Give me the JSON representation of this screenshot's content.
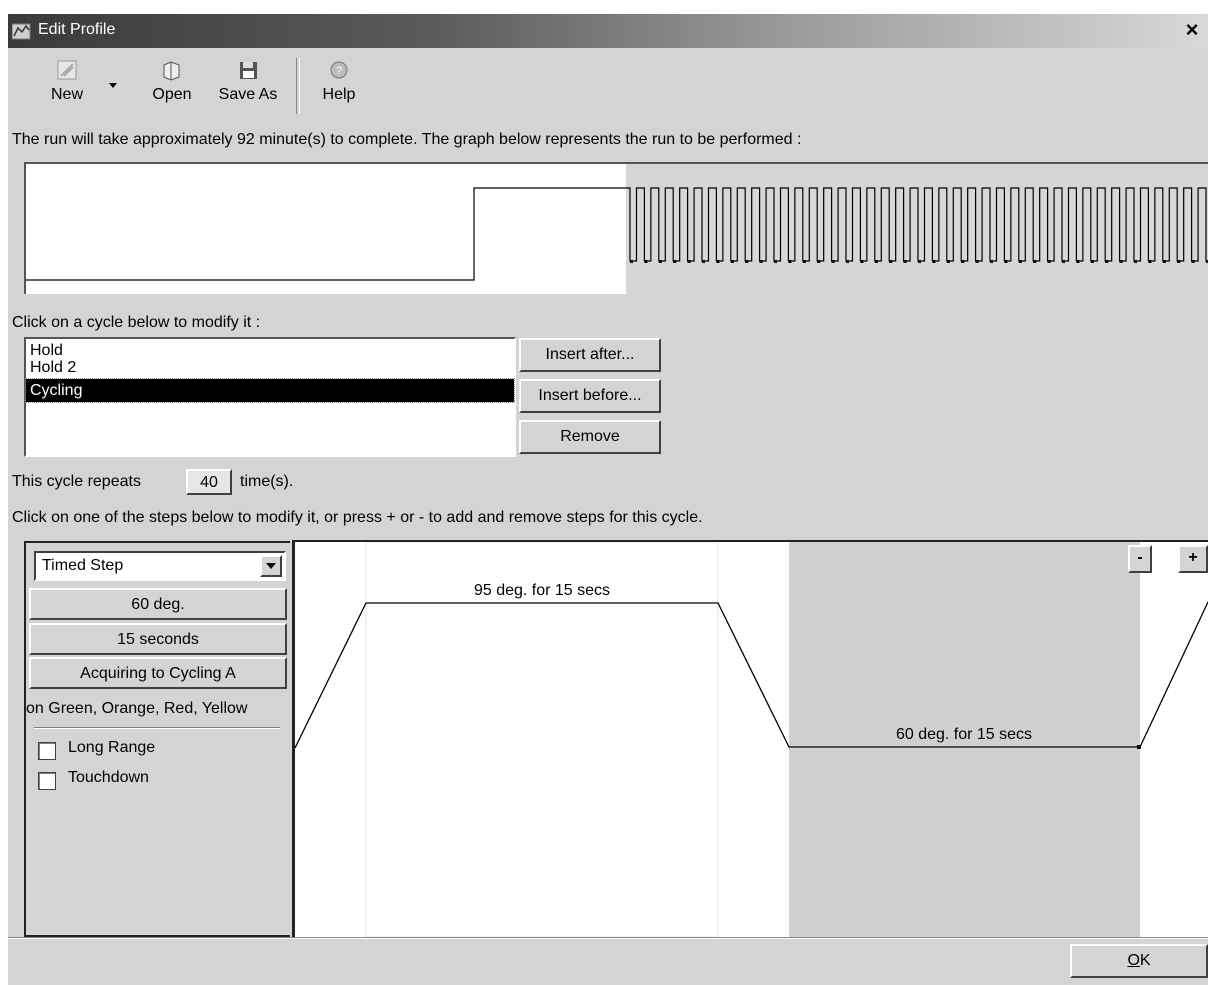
{
  "window": {
    "title": "Edit Profile",
    "close_label": "×"
  },
  "toolbar": {
    "new_label": "New",
    "open_label": "Open",
    "save_as_label": "Save As",
    "help_label": "Help"
  },
  "summary_text": "The run will take approximately 92 minute(s) to complete. The graph below represents the run to be performed :",
  "cycles": {
    "prompt": "Click on a cycle below to modify it :",
    "items": [
      "Hold",
      "Hold 2",
      "Cycling"
    ],
    "selected": "Cycling",
    "insert_after_label": "Insert after...",
    "insert_before_label": "Insert before...",
    "remove_label": "Remove"
  },
  "repeat": {
    "prefix": "This cycle repeats",
    "count": "40",
    "suffix": "time(s)."
  },
  "steps_prompt": "Click on one of the steps below to modify it, or press + or - to add and remove steps for this cycle.",
  "step_editor": {
    "type_value": "Timed Step",
    "temperature": "60 deg.",
    "duration": "15 seconds",
    "acquiring": "Acquiring to Cycling A",
    "channels": "on Green, Orange, Red, Yellow",
    "long_range_label": "Long Range",
    "touchdown_label": "Touchdown",
    "long_range_checked": false,
    "touchdown_checked": false
  },
  "steps": [
    {
      "label": "95 deg. for 15 secs"
    },
    {
      "label": "60 deg. for 15 secs",
      "selected": true
    }
  ],
  "step_controls": {
    "minus_label": "-",
    "plus_label": "+"
  },
  "ok_label": "OK",
  "colors": {
    "selected_step_bg": "#d0d0d0",
    "titlebar_start": "#3a3a3a",
    "titlebar_end": "#d8d8d8"
  }
}
